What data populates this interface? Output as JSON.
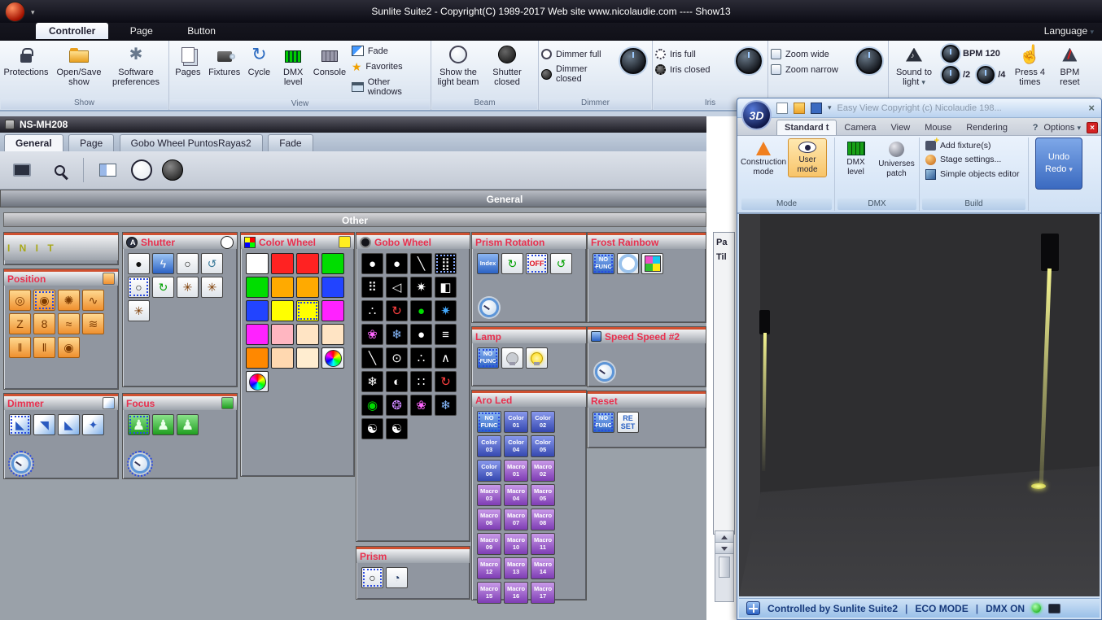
{
  "glyphs": {
    "dropdown": "▾",
    "close": "×",
    "question": "?",
    "gear": "✱",
    "cycle": "↻",
    "star": "★",
    "hand": "☝",
    "pipe": "|"
  },
  "titlebar": {
    "title": "Sunlite Suite2 - Copyright(C) 1989-2017    Web site www.nicolaudie.com ---- Show13",
    "language": "Language"
  },
  "tabs": [
    "Controller",
    "Page",
    "Button"
  ],
  "ribbon": {
    "show": {
      "label": "Show",
      "items": [
        "Protections",
        "Open/Save show",
        "Software preferences"
      ]
    },
    "view": {
      "label": "View",
      "big": [
        "Pages",
        "Fixtures",
        "Cycle",
        "DMX level",
        "Console"
      ],
      "small": [
        "Fade",
        "Favorites",
        "Other windows"
      ]
    },
    "beam": {
      "label": "Beam",
      "items": [
        "Show the light beam",
        "Shutter closed"
      ]
    },
    "dimmer": {
      "label": "Dimmer",
      "items": [
        "Dimmer full",
        "Dimmer closed"
      ]
    },
    "iris": {
      "label": "Iris",
      "items": [
        "Iris full",
        "Iris closed"
      ]
    },
    "zoom": {
      "items": [
        "Zoom wide",
        "Zoom narrow"
      ]
    },
    "sound": {
      "sound_to_light": "Sound to light",
      "bpm": "BPM 120",
      "div2": "/2",
      "div4": "/4",
      "press": "Press 4 times",
      "reset": "BPM reset"
    }
  },
  "fixture_window": {
    "title": "NS-MH208",
    "tabs": [
      "General",
      "Page",
      "Gobo Wheel PuntosRayas2",
      "Fade"
    ],
    "general_bar": "General",
    "other_bar": "Other",
    "pan": "Pa",
    "tilt": "Til",
    "panels": {
      "init": {
        "title": "I N I T"
      },
      "position": {
        "title": "Position",
        "cells": [
          {
            "g": "◎"
          },
          {
            "g": "◉",
            "sel": true
          },
          {
            "g": "✺"
          },
          {
            "g": "∿"
          },
          {
            "g": "Z"
          },
          {
            "g": "8"
          },
          {
            "g": "≈"
          },
          {
            "g": "≋"
          },
          {
            "g": "‖"
          },
          {
            "g": "‖"
          },
          {
            "g": "◉"
          }
        ]
      },
      "shutter": {
        "title": "Shutter",
        "cells": [
          {
            "g": "●",
            "fg": "#111"
          },
          {
            "g": "ϟ",
            "cls": "bluesq"
          },
          {
            "g": "○",
            "fg": "#111"
          },
          {
            "g": "↺",
            "fg": "#3a7a9a"
          },
          {
            "g": "○",
            "fg": "#111",
            "sel": true
          },
          {
            "g": "↻",
            "fg": "#00a000"
          },
          {
            "g": "✳",
            "cls": "poscell",
            "fg": "#7c3a00"
          },
          {
            "g": "✳",
            "fg": "#7c3a00"
          },
          {
            "g": "✳",
            "fg": "#7c3a00"
          }
        ]
      },
      "color_wheel": {
        "title": "Color Wheel",
        "cells": [
          {
            "c": "#ffffff"
          },
          {
            "c": "#ff2222"
          },
          {
            "c": "#ff2222"
          },
          {
            "c": "#00dd00"
          },
          {
            "c": "#00dd00"
          },
          {
            "c": "#ffaa00"
          },
          {
            "c": "#ffaa00"
          },
          {
            "c": "#2244ff"
          },
          {
            "c": "#2244ff"
          },
          {
            "c": "#ffff00"
          },
          {
            "c": "#ffff00",
            "sel": true
          },
          {
            "c": "#ff22ff"
          },
          {
            "c": "#ff22ff"
          },
          {
            "c": "#ffb6c1"
          },
          {
            "c": "#ffe4c4"
          },
          {
            "c": "#ffe4c4"
          },
          {
            "c": "#ff8800"
          },
          {
            "c": "#ffd8b0"
          },
          {
            "c": "#ffedd0"
          },
          {
            "cls": "cwheel"
          },
          {
            "cls": "cwheel"
          }
        ]
      },
      "gobo_wheel": {
        "title": "Gobo Wheel",
        "cells": [
          {
            "g": "●"
          },
          {
            "g": "●"
          },
          {
            "g": "╲"
          },
          {
            "g": "⣿",
            "sel": true
          },
          {
            "g": "⠿"
          },
          {
            "g": "◁"
          },
          {
            "g": "✷"
          },
          {
            "g": "◧"
          },
          {
            "g": "∴"
          },
          {
            "g": "↻",
            "fg": "#ff4040"
          },
          {
            "g": "●",
            "fg": "#00dd00"
          },
          {
            "g": "✷",
            "fg": "#44aaff"
          },
          {
            "g": "❀",
            "fg": "#ff66ff"
          },
          {
            "g": "❄",
            "fg": "#88bbff"
          },
          {
            "g": "●"
          },
          {
            "g": "≡"
          },
          {
            "g": "╲"
          },
          {
            "g": "⊙"
          },
          {
            "g": "∴"
          },
          {
            "g": "∧"
          },
          {
            "g": "❄"
          },
          {
            "g": "◐"
          },
          {
            "g": "∷"
          },
          {
            "g": "↻",
            "fg": "#ff4040"
          },
          {
            "g": "◉",
            "fg": "#00dd00"
          },
          {
            "g": "❂",
            "fg": "#cc88ff"
          },
          {
            "g": "❀",
            "fg": "#ff66ff"
          },
          {
            "g": "❄",
            "fg": "#88bbff"
          },
          {
            "g": "☯"
          },
          {
            "g": "☯"
          }
        ]
      },
      "prism_rotation": {
        "title": "Prism Rotation",
        "cells": [
          {
            "t": "Index",
            "cls": "nofunc"
          },
          {
            "g": "↻",
            "fg": "#00a000"
          },
          {
            "t": "OFF",
            "cls": "offbtn",
            "sel": true
          },
          {
            "g": "↺",
            "fg": "#00a000"
          }
        ]
      },
      "lamp": {
        "title": "Lamp",
        "cells": [
          {
            "t": "NO\nFUNC",
            "cls": "nofunc",
            "sel": true
          },
          {
            "cls": "bulb off"
          },
          {
            "cls": "bulb on"
          }
        ]
      },
      "aro_led": {
        "title": "Aro Led",
        "cells": [
          {
            "t": "NO\nFUNC",
            "cls": "nofunc",
            "sel": true
          },
          {
            "t": "Color\n01",
            "cls": "colbtn"
          },
          {
            "t": "Color\n02",
            "cls": "colbtn"
          },
          {
            "t": "Color\n03",
            "cls": "colbtn"
          },
          {
            "t": "Color\n04",
            "cls": "colbtn"
          },
          {
            "t": "Color\n05",
            "cls": "colbtn"
          },
          {
            "t": "Color\n06",
            "cls": "colbtn"
          },
          {
            "t": "Macro\n01",
            "cls": "macro"
          },
          {
            "t": "Macro\n02",
            "cls": "macro"
          },
          {
            "t": "Macro\n03",
            "cls": "macro"
          },
          {
            "t": "Macro\n04",
            "cls": "macro"
          },
          {
            "t": "Macro\n05",
            "cls": "macro"
          },
          {
            "t": "Macro\n06",
            "cls": "macro"
          },
          {
            "t": "Macro\n07",
            "cls": "macro"
          },
          {
            "t": "Macro\n08",
            "cls": "macro"
          },
          {
            "t": "Macro\n09",
            "cls": "macro"
          },
          {
            "t": "Macro\n10",
            "cls": "macro"
          },
          {
            "t": "Macro\n11",
            "cls": "macro"
          },
          {
            "t": "Macro\n12",
            "cls": "macro"
          },
          {
            "t": "Macro\n13",
            "cls": "macro"
          },
          {
            "t": "Macro\n14",
            "cls": "macro"
          },
          {
            "t": "Macro\n15",
            "cls": "macro"
          },
          {
            "t": "Macro\n16",
            "cls": "macro"
          },
          {
            "t": "Macro\n17",
            "cls": "macro"
          }
        ]
      },
      "frost": {
        "title": "Frost Rainbow",
        "cells": [
          {
            "t": "NO\nFUNC",
            "cls": "nofunc",
            "sel": true
          },
          {
            "cls": "lens"
          },
          {
            "cls": "quad"
          }
        ]
      },
      "speed": {
        "title": "Speed Speed #2"
      },
      "reset": {
        "title": "Reset",
        "cells": [
          {
            "t": "NO\nFUNC",
            "cls": "nofunc",
            "sel": true
          },
          {
            "t": "RE\nSET",
            "cls": "resetbtn"
          }
        ]
      },
      "dimmer": {
        "title": "Dimmer",
        "cells": [
          {
            "g": "◣",
            "cls": "bluegrad",
            "sel": true
          },
          {
            "g": "◥",
            "cls": "bluegrad"
          },
          {
            "g": "◣",
            "cls": "bluegrad"
          },
          {
            "g": "✦",
            "cls": "bluegrad"
          }
        ]
      },
      "focus": {
        "title": "Focus",
        "cells": [
          {
            "g": "♟",
            "cls": "greenbtn",
            "sel": true
          },
          {
            "g": "♟",
            "cls": "greenbtn"
          },
          {
            "g": "♟",
            "cls": "greenbtn"
          }
        ]
      },
      "prism": {
        "title": "Prism",
        "cells": [
          {
            "g": "○",
            "fg": "#111",
            "sel": true
          },
          {
            "g": "◔",
            "fg": "#223a66"
          }
        ]
      }
    }
  },
  "easy_view": {
    "logo": "3D",
    "title": "Easy View  Copyright (c) Nicolaudie 198...",
    "tabs": [
      "Standard t",
      "Camera",
      "View",
      "Mouse",
      "Rendering"
    ],
    "options": "Options",
    "mode": {
      "label": "Mode",
      "construction": "Construction mode",
      "user": "User mode"
    },
    "dmx": {
      "label": "DMX",
      "level": "DMX level",
      "patch": "Universes patch"
    },
    "build": {
      "label": "Build",
      "items": [
        "Add fixture(s)",
        "Stage settings...",
        "Simple objects editor"
      ]
    },
    "undo": "Undo",
    "redo": "Redo",
    "status": {
      "controlled": "Controlled by Sunlite Suite2",
      "eco": "ECO MODE",
      "dmx_on": "DMX ON"
    }
  }
}
